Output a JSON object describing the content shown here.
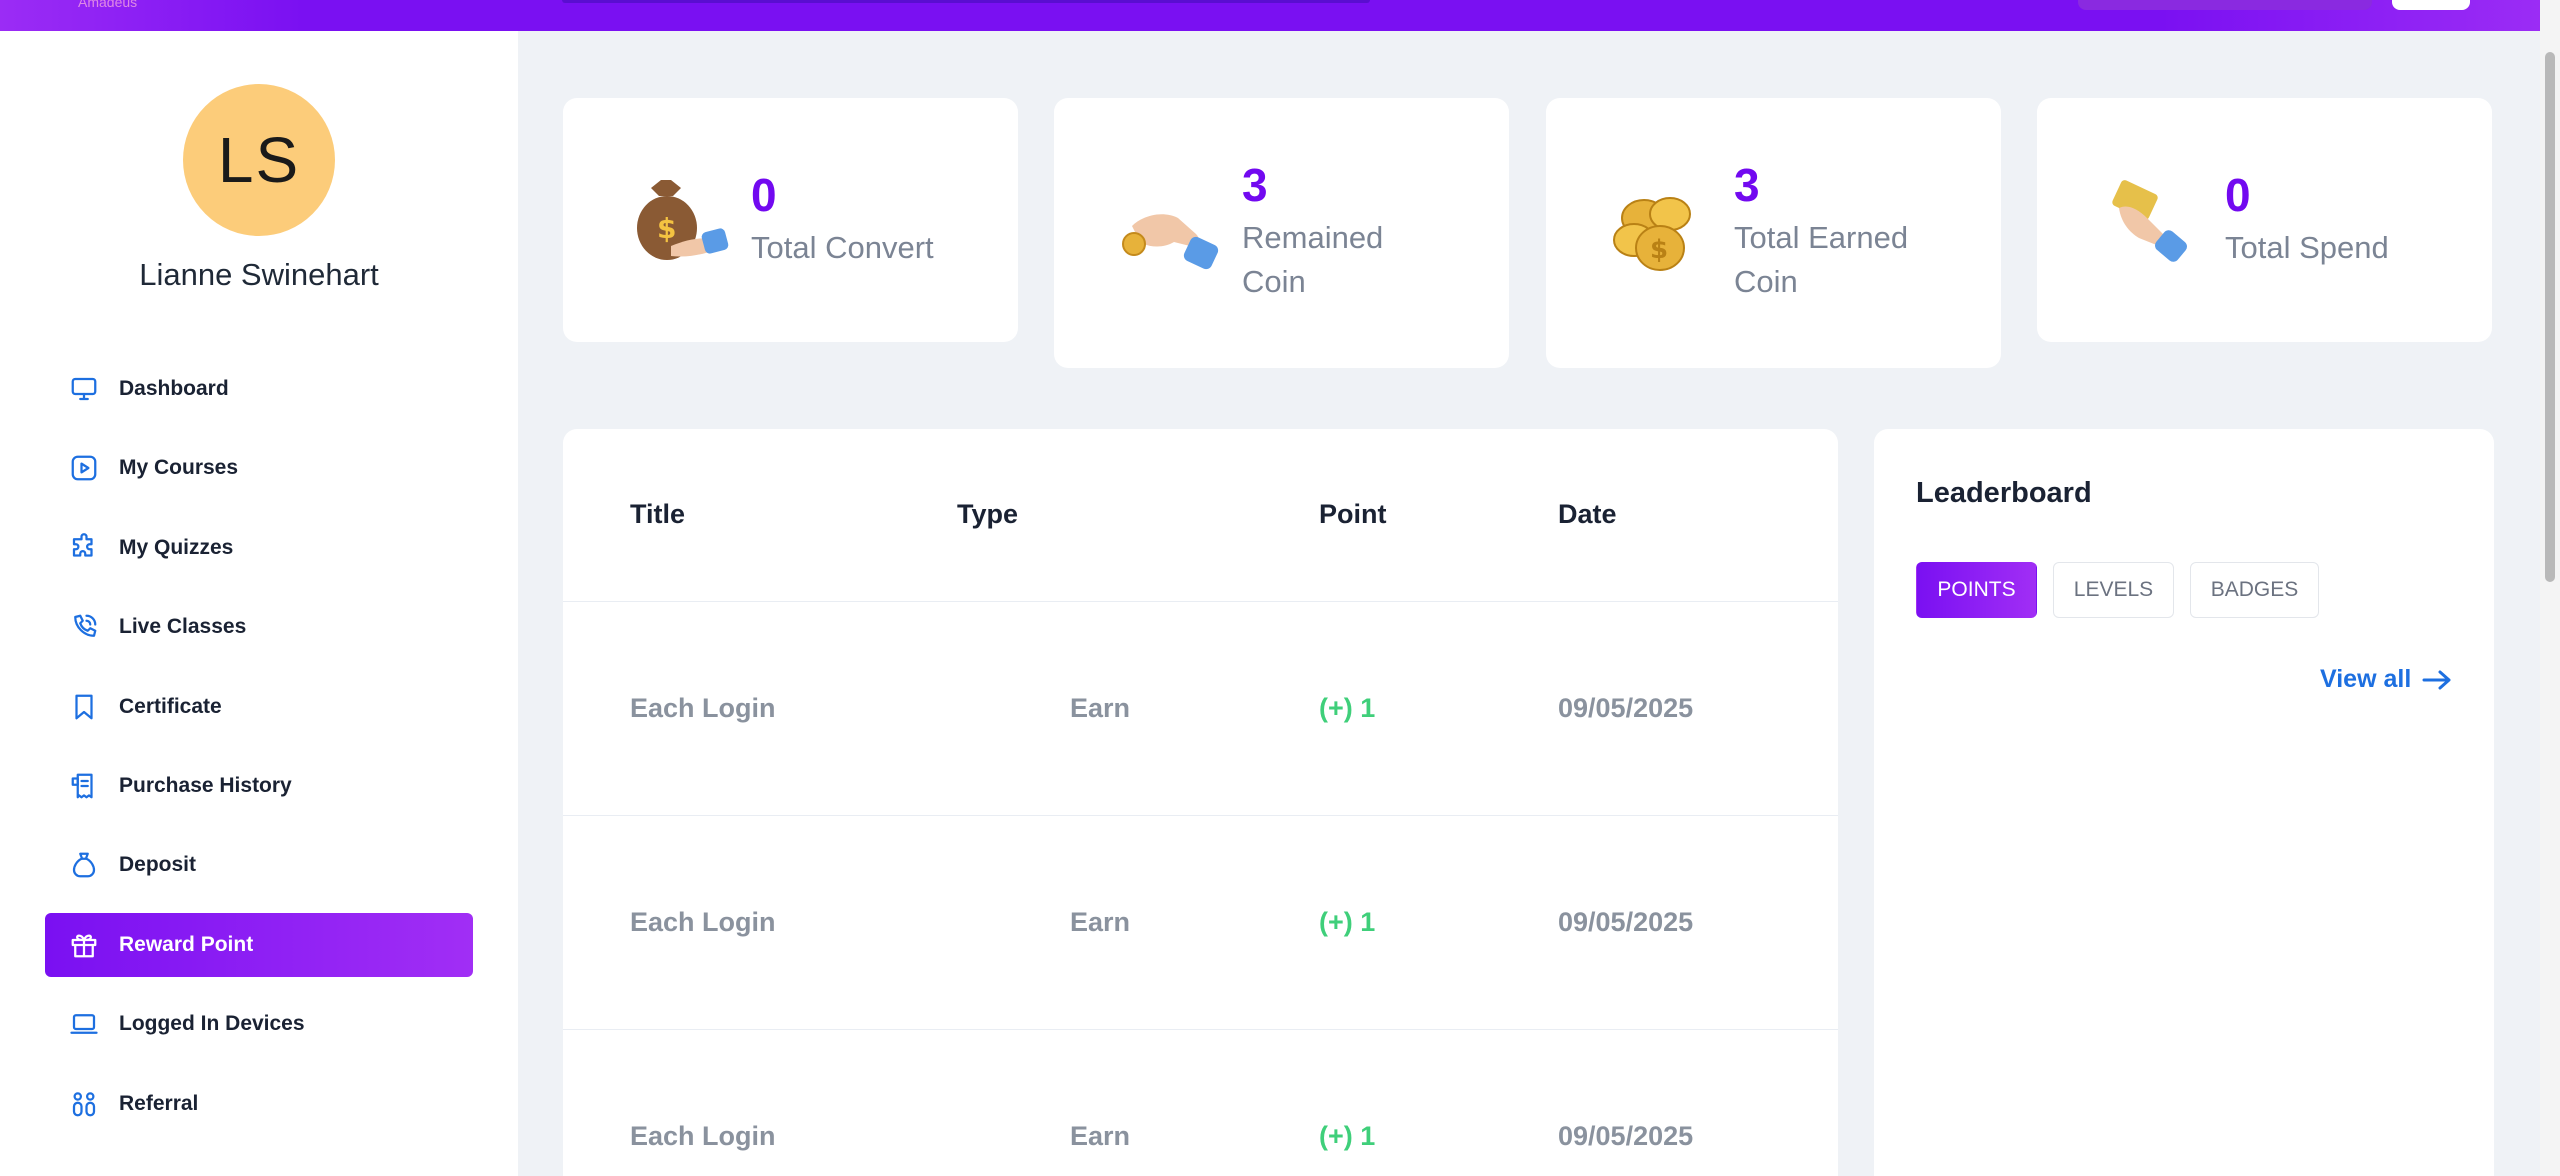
{
  "header": {
    "brand": "Amadeus"
  },
  "user": {
    "initials": "LS",
    "name": "Lianne Swinehart"
  },
  "sidebar": {
    "items": [
      {
        "label": "Dashboard",
        "icon": "monitor-icon"
      },
      {
        "label": "My Courses",
        "icon": "play-square-icon"
      },
      {
        "label": "My Quizzes",
        "icon": "puzzle-icon"
      },
      {
        "label": "Live Classes",
        "icon": "broadcast-icon"
      },
      {
        "label": "Certificate",
        "icon": "bookmark-icon"
      },
      {
        "label": "Purchase History",
        "icon": "receipt-icon"
      },
      {
        "label": "Deposit",
        "icon": "money-bag-icon"
      },
      {
        "label": "Reward Point",
        "icon": "gift-icon",
        "active": true
      },
      {
        "label": "Logged In Devices",
        "icon": "laptop-icon"
      },
      {
        "label": "Referral",
        "icon": "people-icon"
      }
    ]
  },
  "stats": [
    {
      "value": "0",
      "label": "Total Convert",
      "icon": "money-bag-hand-icon"
    },
    {
      "value": "3",
      "label": "Remained Coin",
      "icon": "hand-coin-icon"
    },
    {
      "value": "3",
      "label": "Total Earned Coin",
      "icon": "coin-stack-icon"
    },
    {
      "value": "0",
      "label": "Total Spend",
      "icon": "hand-card-icon"
    }
  ],
  "table": {
    "headers": [
      "Title",
      "Type",
      "Point",
      "Date"
    ],
    "rows": [
      {
        "title": "Each Login",
        "type": "Earn",
        "point": "(+) 1",
        "date": "09/05/2025"
      },
      {
        "title": "Each Login",
        "type": "Earn",
        "point": "(+) 1",
        "date": "09/05/2025"
      },
      {
        "title": "Each Login",
        "type": "Earn",
        "point": "(+) 1",
        "date": "09/05/2025"
      }
    ]
  },
  "leaderboard": {
    "title": "Leaderboard",
    "tabs": [
      "POINTS",
      "LEVELS",
      "BADGES"
    ],
    "active_tab": "POINTS",
    "view_all": "View all"
  },
  "colors": {
    "accent": "#7a10f2",
    "link": "#1d6fe0",
    "positive": "#3fcf7a",
    "avatar": "#fccc7a"
  }
}
